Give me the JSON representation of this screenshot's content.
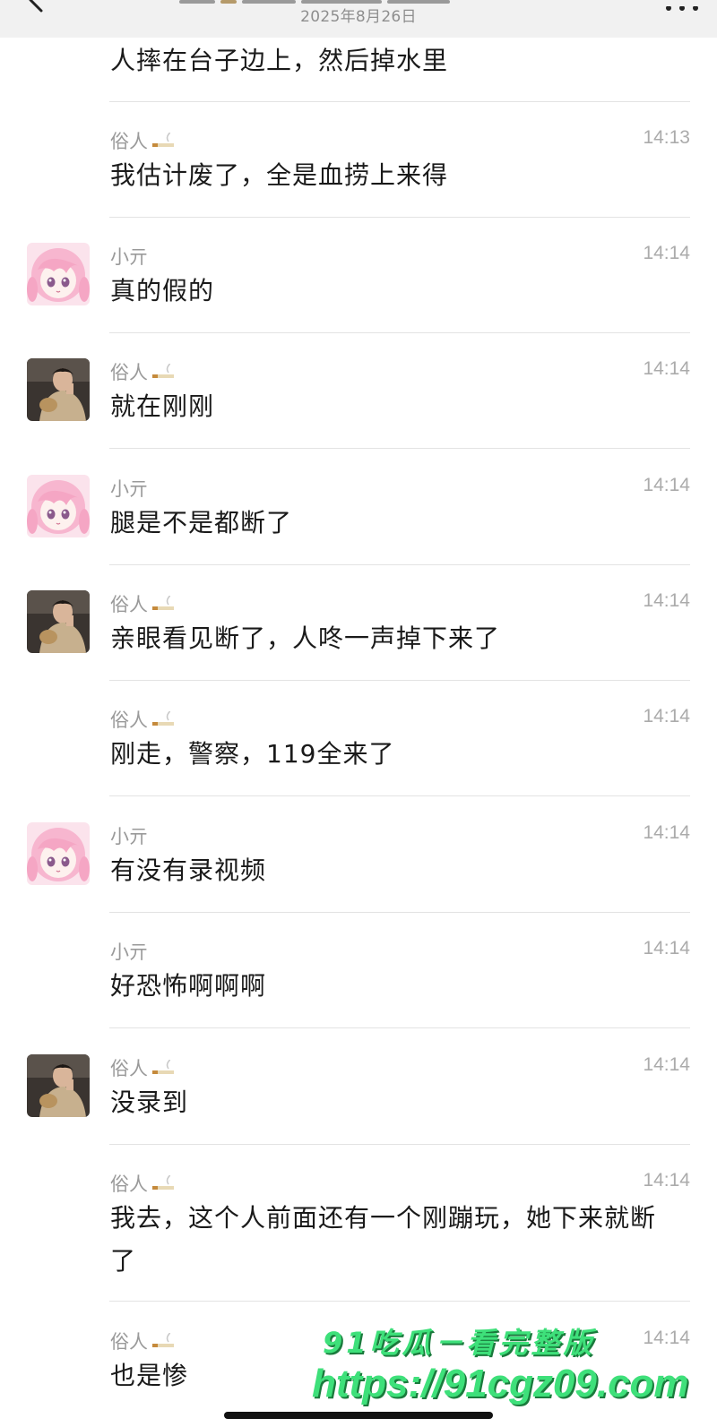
{
  "header": {
    "date": "2025年8月26日",
    "back_icon": "chevron-left-icon",
    "more_icon": "more-dots-icon"
  },
  "messages": [
    {
      "sender": "",
      "time": "",
      "text": "人摔在台子边上，然后掉水里",
      "avatar": ""
    },
    {
      "sender": "俗人",
      "time": "14:13",
      "text": "我估计废了，全是血捞上来得",
      "avatar": ""
    },
    {
      "sender": "小亓",
      "time": "14:14",
      "text": "真的假的",
      "avatar": "anime-girl"
    },
    {
      "sender": "俗人",
      "time": "14:14",
      "text": "就在刚刚",
      "avatar": "man-photo"
    },
    {
      "sender": "小亓",
      "time": "14:14",
      "text": "腿是不是都断了",
      "avatar": "anime-girl"
    },
    {
      "sender": "俗人",
      "time": "14:14",
      "text": "亲眼看见断了，人咚一声掉下来了",
      "avatar": "man-photo"
    },
    {
      "sender": "俗人",
      "time": "14:14",
      "text": "刚走，警察，119全来了",
      "avatar": ""
    },
    {
      "sender": "小亓",
      "time": "14:14",
      "text": "有没有录视频",
      "avatar": "anime-girl"
    },
    {
      "sender": "小亓",
      "time": "14:14",
      "text": "好恐怖啊啊啊",
      "avatar": ""
    },
    {
      "sender": "俗人",
      "time": "14:14",
      "text": "没录到",
      "avatar": "man-photo"
    },
    {
      "sender": "俗人",
      "time": "14:14",
      "text": "我去，这个人前面还有一个刚蹦玩，她下来就断了",
      "avatar": ""
    },
    {
      "sender": "俗人",
      "time": "14:14",
      "text": "也是惨",
      "avatar": ""
    }
  ],
  "watermark": {
    "line1": "91吃瓜－看完整版",
    "line2": "https://91cgz09.com"
  },
  "colors": {
    "header_bg": "#f1f1f1",
    "sender_text": "#9a9a9a",
    "time_text": "#ababab",
    "message_text": "#1a1a1a",
    "divider": "#e3e3e3",
    "watermark_green": "#3ee07a"
  }
}
